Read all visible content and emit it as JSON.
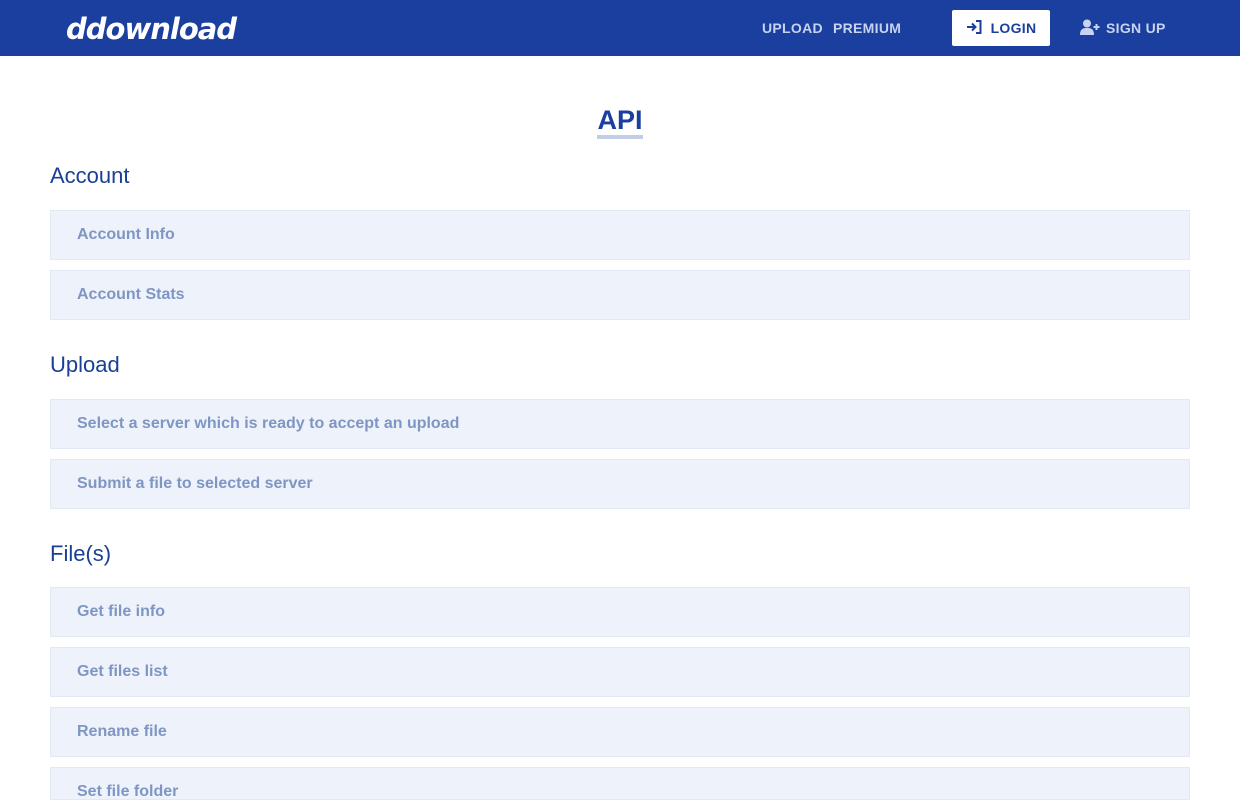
{
  "header": {
    "logo": "ddownload",
    "nav": {
      "upload": "UPLOAD",
      "premium": "PREMIUM"
    },
    "login_label": "LOGIN",
    "signup_label": "SIGN UP",
    "colors": {
      "bar": "#1a3f9e",
      "login_bg": "#ffffff"
    }
  },
  "page": {
    "title": "API"
  },
  "sections": [
    {
      "heading": "Account",
      "items": [
        "Account Info",
        "Account Stats"
      ]
    },
    {
      "heading": "Upload",
      "items": [
        "Select a server which is ready to accept an upload",
        "Submit a file to selected server"
      ]
    },
    {
      "heading": "File(s)",
      "items": [
        "Get file info",
        "Get files list",
        "Rename file",
        "Set file folder"
      ]
    }
  ]
}
